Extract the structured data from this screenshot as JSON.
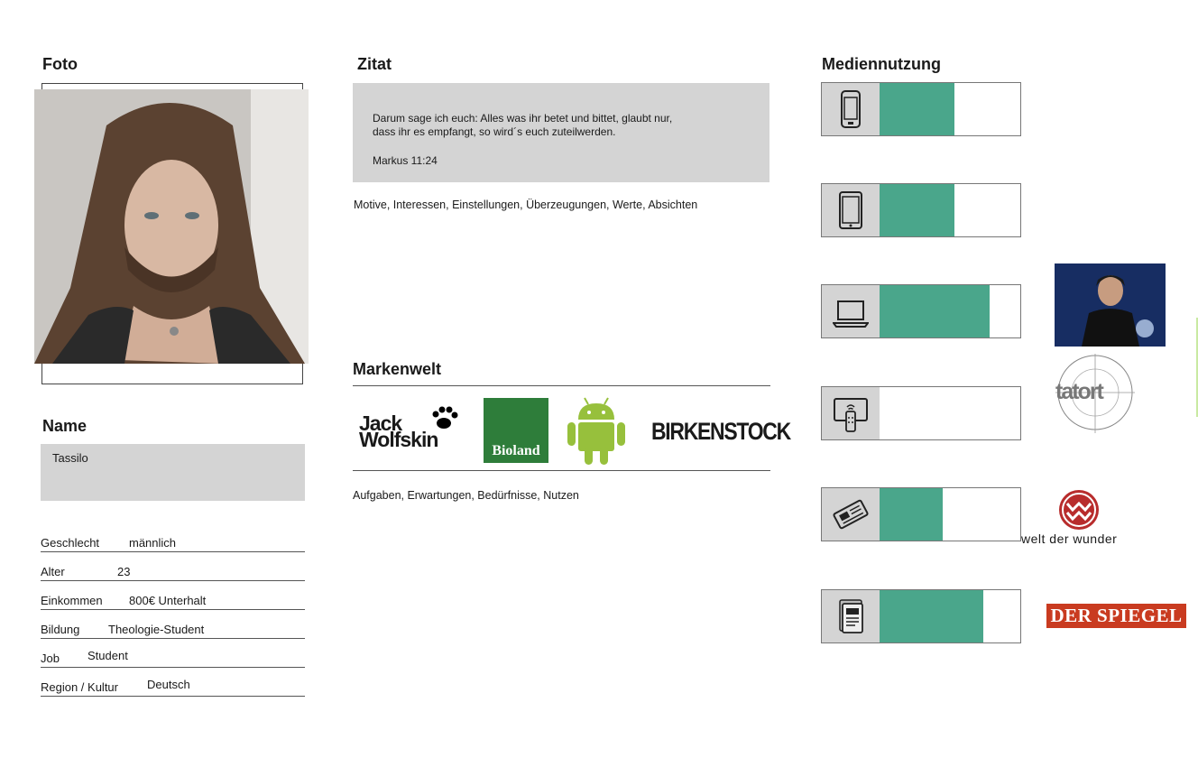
{
  "foto": {
    "heading": "Foto"
  },
  "name": {
    "heading": "Name",
    "value": "Tassilo"
  },
  "attributes": [
    {
      "label": "Geschlecht",
      "value": "männlich"
    },
    {
      "label": "Alter",
      "value": "23"
    },
    {
      "label": "Einkommen",
      "value": "800€ Unterhalt"
    },
    {
      "label": "Bildung",
      "value": "Theologie-Student"
    },
    {
      "label": "Job",
      "value": "Student"
    },
    {
      "label": "Region / Kultur",
      "value": "Deutsch"
    }
  ],
  "zitat": {
    "heading": "Zitat",
    "text": "Darum sage ich euch: Alles was ihr betet und bittet, glaubt nur,\ndass ihr es empfangt, so wird´s euch zuteilwerden.",
    "source": "Markus 11:24",
    "note": "Motive, Interessen, Einstellungen, Überzeugungen, Werte, Absichten"
  },
  "markenwelt": {
    "heading": "Markenwelt",
    "brands": {
      "jack_top": "Jack",
      "jack_bottom": "Wolfskin",
      "bioland": "Bioland",
      "android": "android-logo",
      "birkenstock": "BIRKENSTOCK"
    },
    "note": "Aufgaben, Erwartungen, Bedürfnisse, Nutzen"
  },
  "mediennutzung": {
    "heading": "Mediennutzung",
    "items": [
      {
        "icon": "smartphone-icon",
        "level_percent": 53
      },
      {
        "icon": "tablet-icon",
        "level_percent": 53
      },
      {
        "icon": "laptop-icon",
        "level_percent": 78
      },
      {
        "icon": "tv-icon",
        "level_percent": 0
      },
      {
        "icon": "newspaper-icon",
        "level_percent": 45
      },
      {
        "icon": "magazine-icon",
        "level_percent": 74
      }
    ],
    "logos": {
      "tatort": "tatort",
      "welt_der_wunder": "welt der wunder",
      "spiegel": "DER SPIEGEL"
    }
  },
  "colors": {
    "accent": "#4aa68b",
    "box_gray": "#d4d4d4",
    "spiegel_red": "#c93b20",
    "wdw_red": "#b82c2c",
    "bioland_green": "#2e7d3a",
    "android_green": "#97c03c"
  }
}
